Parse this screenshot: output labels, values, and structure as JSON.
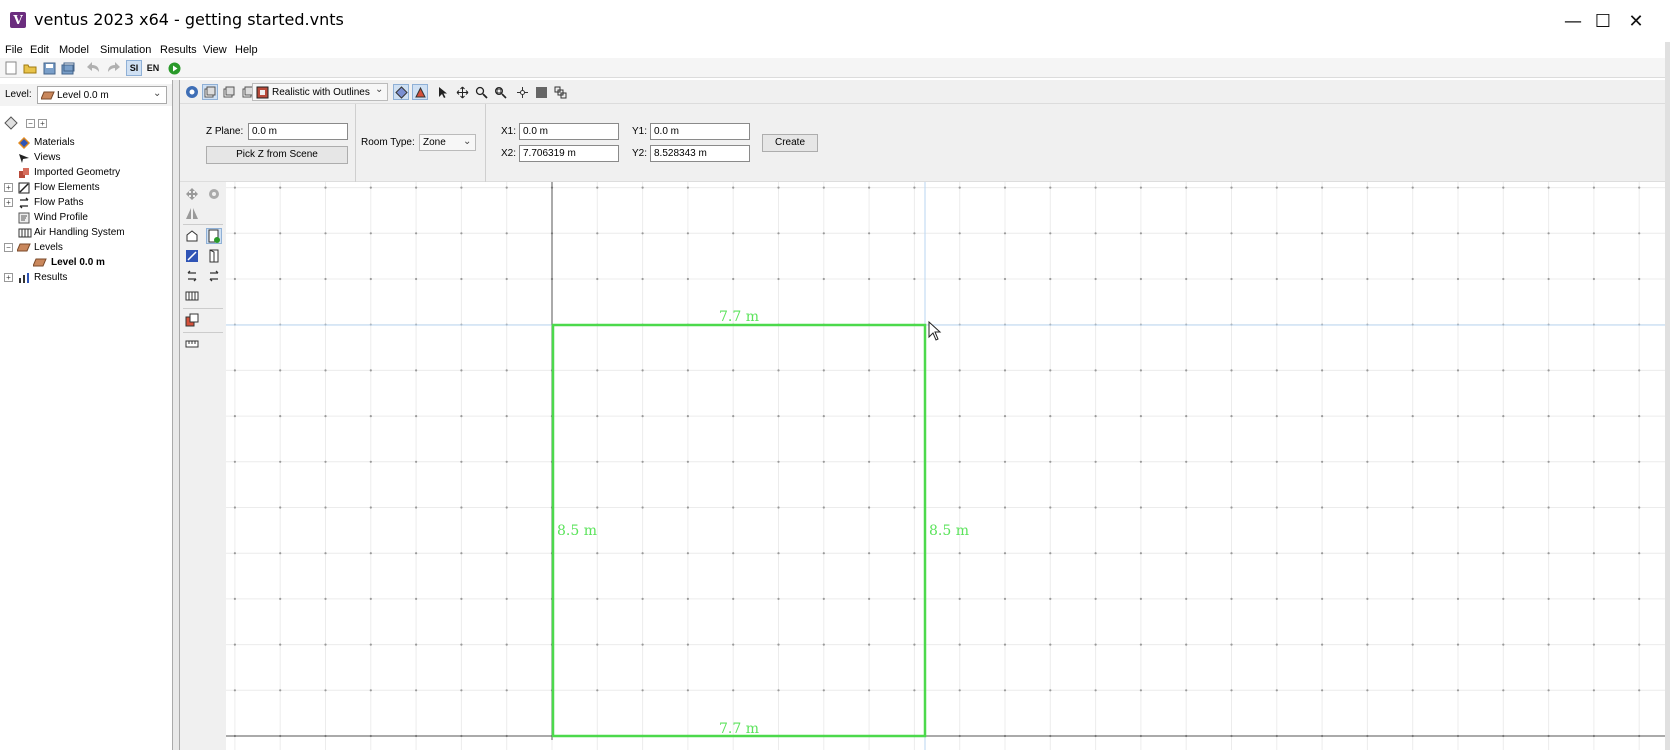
{
  "window": {
    "title": "ventus 2023 x64 - getting started.vnts",
    "app_icon_letter": "V",
    "minimize": "—",
    "maximize": "☐",
    "close": "✕"
  },
  "menu": [
    "File",
    "Edit",
    "Model",
    "Simulation",
    "Results",
    "View",
    "Help"
  ],
  "toolbar": {
    "si_label": "SI",
    "en_label": "EN"
  },
  "level_selector": {
    "label": "Level:",
    "value": "Level 0.0 m"
  },
  "tree": {
    "items": [
      {
        "label": "Materials"
      },
      {
        "label": "Views"
      },
      {
        "label": "Imported Geometry"
      },
      {
        "label": "Flow Elements"
      },
      {
        "label": "Flow Paths"
      },
      {
        "label": "Wind Profile"
      },
      {
        "label": "Air Handling System"
      },
      {
        "label": "Levels"
      },
      {
        "label": "Level 0.0 m"
      },
      {
        "label": "Results"
      }
    ]
  },
  "view_toolbar": {
    "render_mode": "Realistic with Outlines"
  },
  "properties": {
    "z_plane_label": "Z Plane:",
    "z_plane_value": "0.0 m",
    "pick_z_button": "Pick Z from Scene",
    "room_type_label": "Room Type:",
    "room_type_value": "Zone",
    "x1_label": "X1:",
    "x1_value": "0.0 m",
    "y1_label": "Y1:",
    "y1_value": "0.0 m",
    "x2_label": "X2:",
    "x2_value": "7.706319 m",
    "y2_label": "Y2:",
    "y2_value": "8.528343 m",
    "create_button": "Create"
  },
  "canvas": {
    "dimensions": {
      "top": "7.7 m",
      "bottom": "7.7 m",
      "left": "8.5 m",
      "right": "8.5 m"
    },
    "room_outline_color": "#4cd94c",
    "cursor_guide_color": "#b9d6f2"
  }
}
